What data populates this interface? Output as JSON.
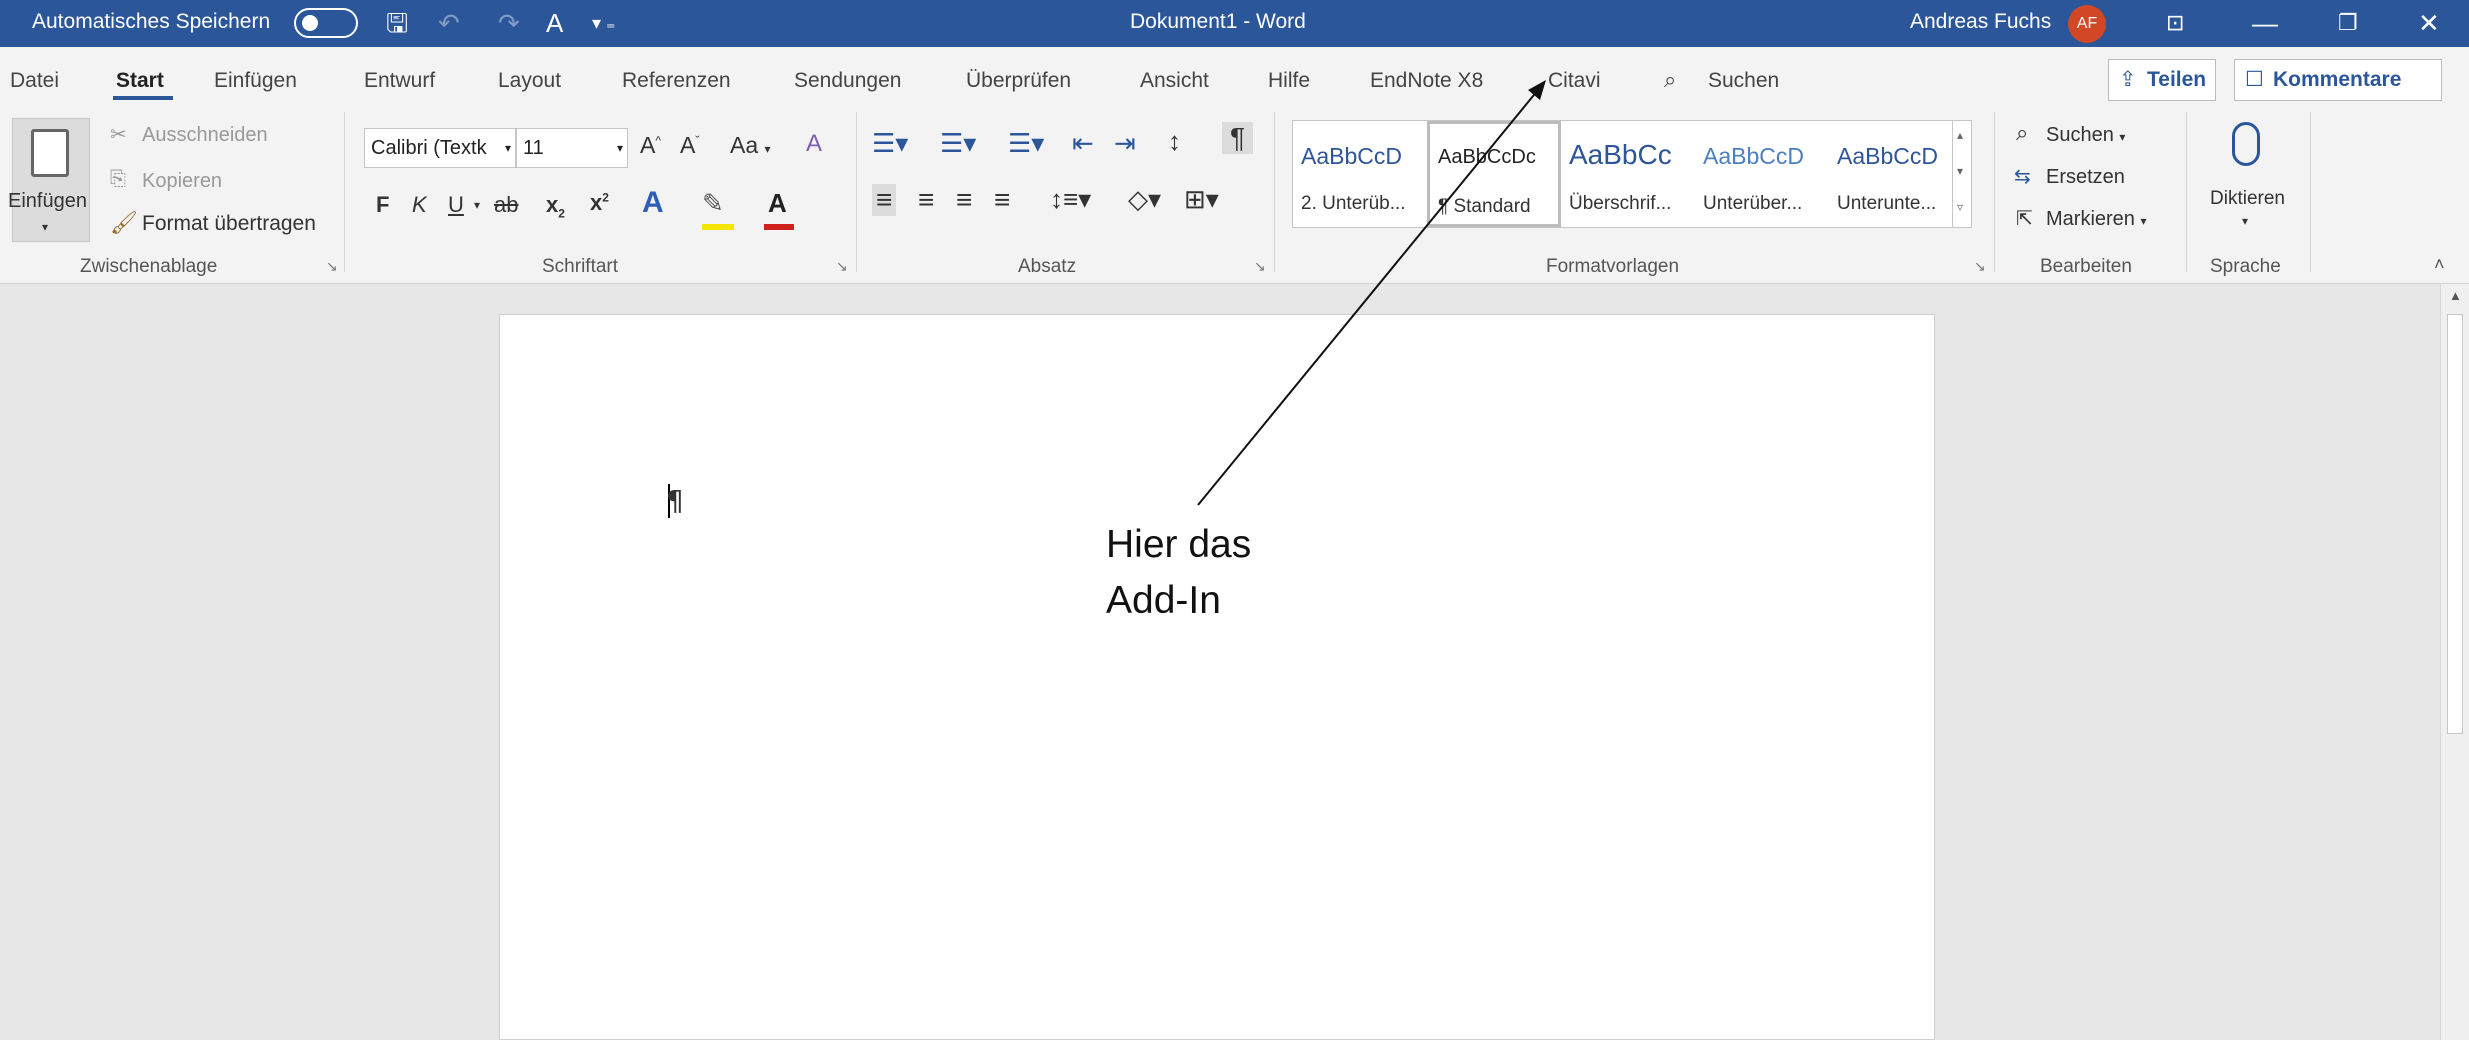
{
  "titlebar": {
    "autosave_label": "Automatisches Speichern",
    "doc_title": "Dokument1  -  Word",
    "user_name": "Andreas Fuchs",
    "user_initials": "AF",
    "icons": [
      "save-icon",
      "undo-icon",
      "redo-icon",
      "spelling-icon",
      "customize-qat-icon",
      "ribbon-display-icon",
      "minimize-icon",
      "restore-icon",
      "close-icon"
    ],
    "bg_color": "#2b579a"
  },
  "tabs": [
    "Datei",
    "Start",
    "Einfügen",
    "Entwurf",
    "Layout",
    "Referenzen",
    "Sendungen",
    "Überprüfen",
    "Ansicht",
    "Hilfe",
    "EndNote X8",
    "Citavi"
  ],
  "active_tab": "Start",
  "search_label": "Suchen",
  "share_label": "Teilen",
  "comments_label": "Kommentare",
  "clipboard": {
    "paste": "Einfügen",
    "cut": "Ausschneiden",
    "copy": "Kopieren",
    "format_painter": "Format übertragen",
    "group": "Zwischenablage"
  },
  "font": {
    "name": "Calibri (Textk",
    "size": "11",
    "bold": "F",
    "italic": "K",
    "underline": "U",
    "strike": "ab",
    "grow": "A",
    "shrink": "A",
    "case": "Aa",
    "group": "Schriftart"
  },
  "paragraph": {
    "group": "Absatz"
  },
  "styles": {
    "items": [
      {
        "sample": "AaBbCcD",
        "name": "2. Unterüb..."
      },
      {
        "sample": "AaBbCcDc",
        "name": "¶ Standard"
      },
      {
        "sample": "AaBbCc",
        "name": "Überschrif..."
      },
      {
        "sample": "AaBbCcD",
        "name": "Unterüber..."
      },
      {
        "sample": "AaBbCcD",
        "name": "Unterunte..."
      }
    ],
    "group": "Formatvorlagen"
  },
  "editing": {
    "find": "Suchen",
    "replace": "Ersetzen",
    "select": "Markieren",
    "group": "Bearbeiten"
  },
  "voice": {
    "dictate": "Diktieren",
    "group": "Sprache"
  },
  "annotation": {
    "line1": "Hier das",
    "line2": "Add-In"
  },
  "document": {
    "pilcrow": "¶"
  },
  "accent_color": "#2b579a",
  "avatar_color": "#d24726"
}
